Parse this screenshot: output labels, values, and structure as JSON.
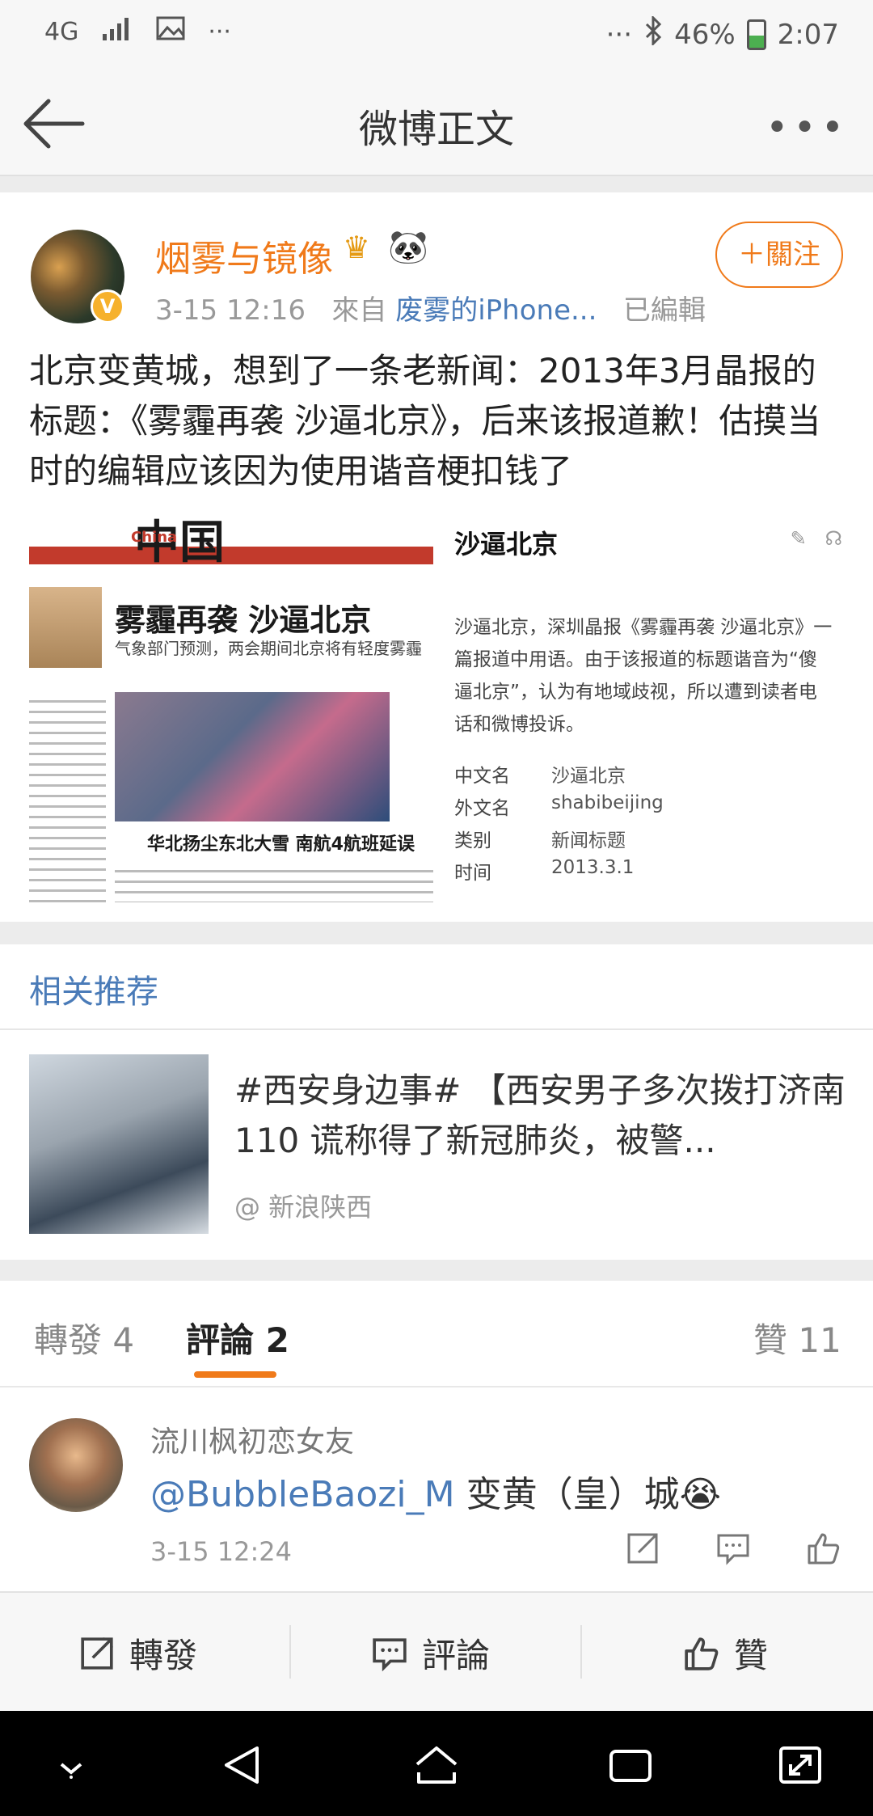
{
  "status_bar": {
    "network": "4G",
    "dots": "···",
    "dots_right": "···",
    "battery": "46%",
    "battery_level": 0.46,
    "time": "2:07"
  },
  "nav": {
    "title": "微博正文",
    "more": "•••"
  },
  "post": {
    "username": "烟雾与镜像",
    "time": "3-15 12:16",
    "from_label": "來自",
    "source": "废雾的iPhone...",
    "edited": "已編輯",
    "follow_label": "＋關注",
    "text": "北京变黄城，想到了一条老新闻：2013年3月晶报的标题：《雾霾再袭 沙逼北京》，后来该报道歉！估摸当时的编辑应该因为使用谐音梗扣钱了",
    "image": {
      "masthead": "中国",
      "masthead_en": "China",
      "headline": "雾霾再袭 沙逼北京",
      "subhead": "气象部门预测，两会期间北京将有轻度雾霾",
      "caption": "华北扬尘东北大雪 南航4航班延误"
    },
    "baike": {
      "title": "沙逼北京",
      "desc": "沙逼北京，深圳晶报《雾霾再袭 沙逼北京》一篇报道中用语。由于该报道的标题谐音为“傻逼北京”，认为有地域歧视，所以遭到读者电话和微博投诉。",
      "rows": [
        {
          "key": "中文名",
          "value": "沙逼北京"
        },
        {
          "key": "外文名",
          "value": "shabibeijing"
        },
        {
          "key": "类别",
          "value": "新闻标题"
        },
        {
          "key": "时间",
          "value": "2013.3.1"
        }
      ]
    }
  },
  "recommend": {
    "title": "相关推荐",
    "item_text": "#西安身边事# 【西安男子多次拨打济南110 谎称得了新冠肺炎，被警...",
    "item_source": "@ 新浪陕西"
  },
  "tabs": {
    "repost": "轉發 4",
    "comment": "評論 2",
    "like": "贊 11"
  },
  "comment": {
    "name": "流川枫初恋女友",
    "mention": "@BubbleBaozi_M",
    "text": " 变黄（皇）城😭",
    "time": "3-15 12:24"
  },
  "bottom_bar": {
    "repost": "轉發",
    "comment": "評論",
    "like": "贊"
  },
  "colors": {
    "accent": "#f07a1a",
    "link": "#4a7bb8"
  }
}
